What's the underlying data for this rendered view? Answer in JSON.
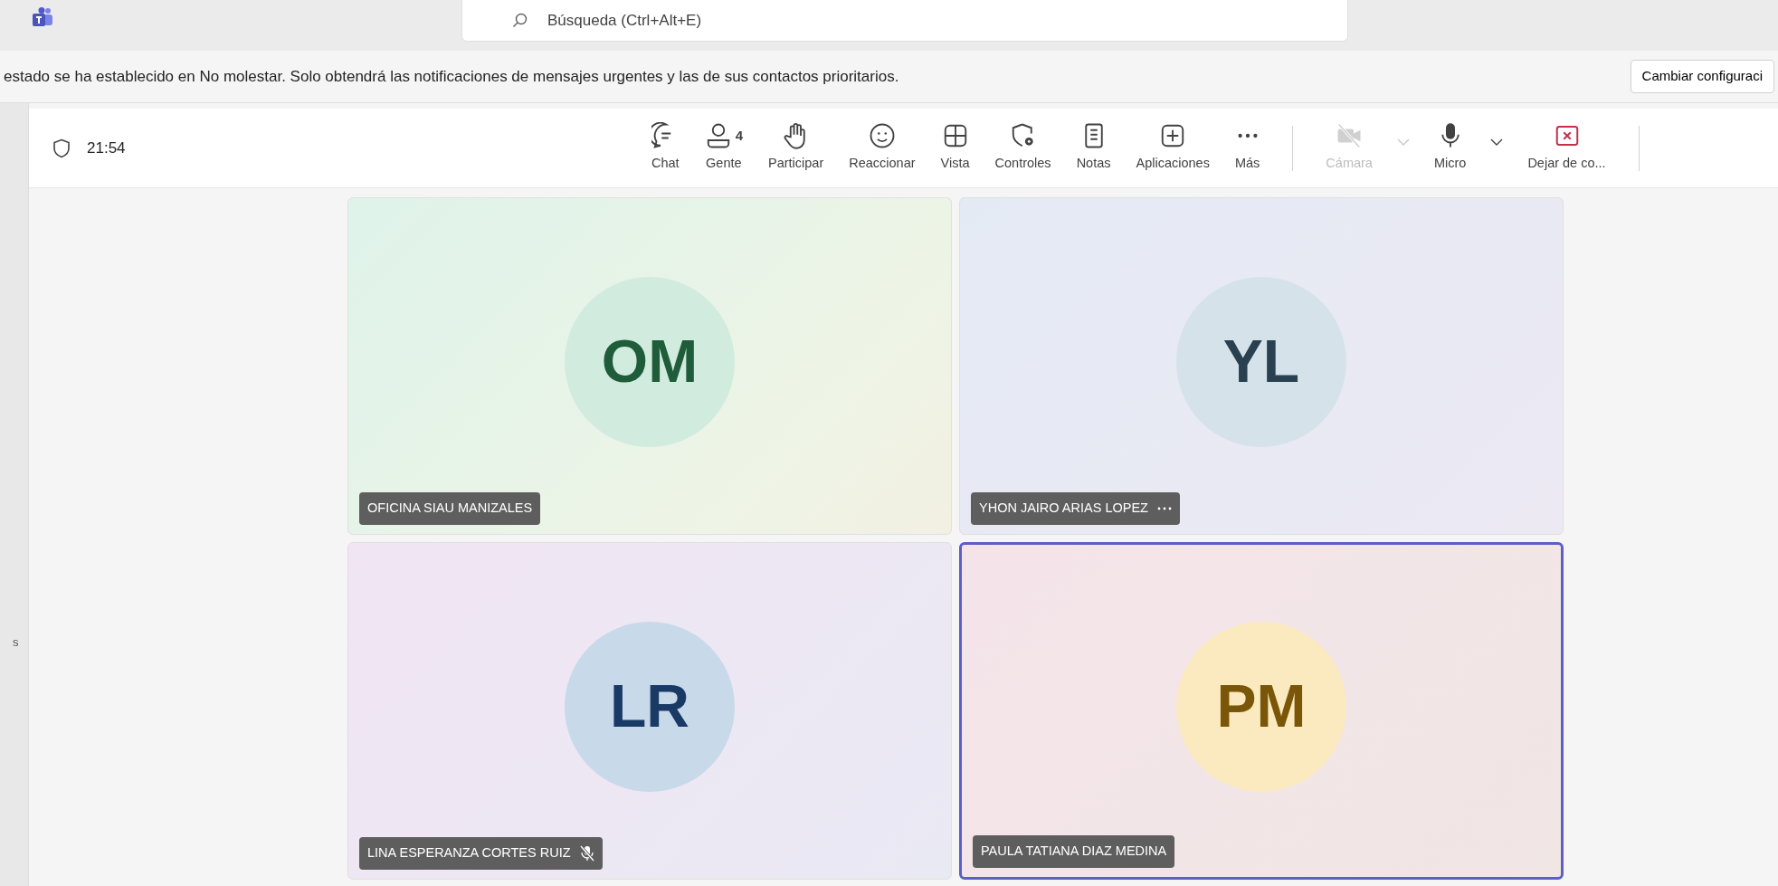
{
  "search": {
    "placeholder": "Búsqueda (Ctrl+Alt+E)"
  },
  "notification": {
    "text": "estado se ha establecido en No molestar. Solo obtendrá las notificaciones de mensajes urgentes y las de sus contactos prioritarios.",
    "button": "Cambiar configuraci"
  },
  "sidebar": {
    "text": "s"
  },
  "meeting": {
    "time": "21:54"
  },
  "toolbar": [
    {
      "kind": "button",
      "label": "Chat",
      "disabled": false
    },
    {
      "kind": "button",
      "label": "Gente",
      "count": "4",
      "disabled": false
    },
    {
      "kind": "button",
      "label": "Participar",
      "disabled": false
    },
    {
      "kind": "button",
      "label": "Reaccionar",
      "disabled": false
    },
    {
      "kind": "button",
      "label": "Vista",
      "disabled": false
    },
    {
      "kind": "button",
      "label": "Controles",
      "disabled": false
    },
    {
      "kind": "button",
      "label": "Notas",
      "disabled": false
    },
    {
      "kind": "button",
      "label": "Aplicaciones",
      "disabled": false
    },
    {
      "kind": "button",
      "label": "Más",
      "disabled": false
    },
    {
      "kind": "divider"
    },
    {
      "kind": "button",
      "label": "Cámara",
      "disabled": true
    },
    {
      "kind": "dropdown",
      "disabled": true
    },
    {
      "kind": "button",
      "label": "Micro",
      "disabled": false
    },
    {
      "kind": "dropdown",
      "disabled": false
    },
    {
      "kind": "leave",
      "label": "Dejar de co...",
      "disabled": false
    },
    {
      "kind": "divider"
    }
  ],
  "participants": [
    {
      "initials": "OM",
      "name": "OFICINA SIAU MANIZALES",
      "color": "#1e5c3a",
      "muted": false,
      "more": false,
      "selected": false
    },
    {
      "initials": "YL",
      "name": "YHON JAIRO ARIAS LOPEZ",
      "color": "#28404f",
      "muted": false,
      "more": true,
      "selected": false
    },
    {
      "initials": "LR",
      "name": "LINA ESPERANZA CORTES RUIZ",
      "color": "#1a3a66",
      "muted": true,
      "more": false,
      "selected": false
    },
    {
      "initials": "PM",
      "name": "PAULA TATIANA DIAZ MEDINA",
      "color": "#7a5608",
      "muted": false,
      "more": false,
      "selected": true
    }
  ]
}
